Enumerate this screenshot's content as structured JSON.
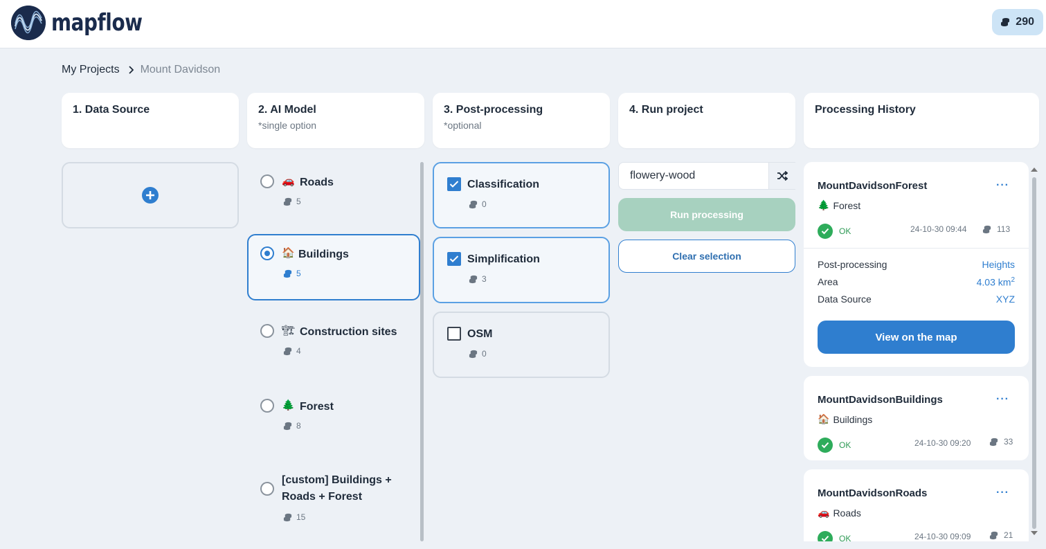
{
  "app": {
    "name": "mapflow"
  },
  "header": {
    "credits": "290"
  },
  "breadcrumb": {
    "root": "My Projects",
    "current": "Mount Davidson"
  },
  "columns": {
    "data_source": {
      "title": "1. Data Source"
    },
    "ai_model": {
      "title": "2. AI Model",
      "subtitle": "*single option"
    },
    "post_processing": {
      "title": "3. Post-processing",
      "subtitle": "*optional"
    },
    "run_project": {
      "title": "4. Run project"
    },
    "history": {
      "title": "Processing History"
    }
  },
  "models": [
    {
      "icon": "🚗",
      "name": "Roads",
      "cost": "5",
      "selected": false
    },
    {
      "icon": "🏠",
      "name": "Buildings",
      "cost": "5",
      "selected": true
    },
    {
      "icon": "🏗",
      "name": "Construction sites",
      "cost": "4",
      "selected": false
    },
    {
      "icon": "🌲",
      "name": "Forest",
      "cost": "8",
      "selected": false
    },
    {
      "icon": "",
      "name": "[custom] Buildings + Roads + Forest",
      "cost": "15",
      "selected": false
    }
  ],
  "post_processing": [
    {
      "name": "Classification",
      "cost": "0",
      "checked": true
    },
    {
      "name": "Simplification",
      "cost": "3",
      "checked": true
    },
    {
      "name": "OSM",
      "cost": "0",
      "checked": false
    }
  ],
  "run": {
    "project_name": "flowery-wood",
    "run_label": "Run processing",
    "clear_label": "Clear selection"
  },
  "history": [
    {
      "title": "MountDavidsonForest",
      "model_icon": "🌲",
      "model": "Forest",
      "status": "OK",
      "date": "24-10-30 09:44",
      "cost": "113",
      "more": "···",
      "details": {
        "post_processing_label": "Post-processing",
        "post_processing_value": "Heights",
        "area_label": "Area",
        "area_value": "4.03 km",
        "area_unit_sup": "2",
        "source_label": "Data Source",
        "source_value": "XYZ"
      },
      "view_label": "View on the map"
    },
    {
      "title": "MountDavidsonBuildings",
      "model_icon": "🏠",
      "model": "Buildings",
      "status": "OK",
      "date": "24-10-30 09:20",
      "cost": "33",
      "more": "···"
    },
    {
      "title": "MountDavidsonRoads",
      "model_icon": "🚗",
      "model": "Roads",
      "status": "OK",
      "date": "24-10-30 09:09",
      "cost": "21",
      "more": "···"
    }
  ],
  "colors": {
    "accent": "#2f7ecf",
    "success": "#2eac5b",
    "run_disabled": "#a7d1bf",
    "background": "#edf1f6"
  },
  "icons": {
    "logo": "mapflow-wave-logo-icon",
    "credits": "coins-stack-icon",
    "add": "plus-circle-icon",
    "shuffle": "shuffle-icon",
    "status": "check-circle-icon"
  }
}
